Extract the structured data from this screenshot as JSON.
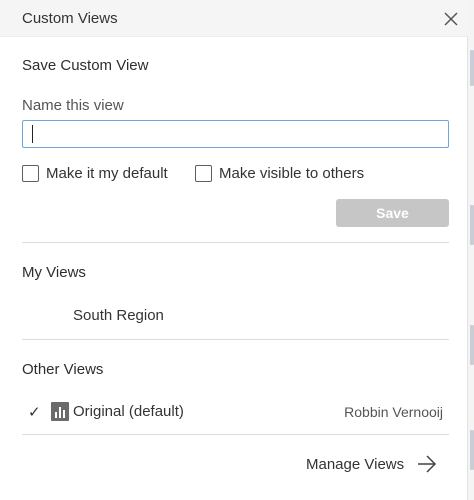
{
  "header": {
    "title": "Custom Views"
  },
  "save_section": {
    "title": "Save Custom View",
    "name_label": "Name this view",
    "name_value": "",
    "default_checkbox_label": "Make it my default",
    "visible_checkbox_label": "Make visible to others",
    "save_button_label": "Save"
  },
  "my_views": {
    "title": "My Views",
    "items": [
      {
        "label": "South Region"
      }
    ]
  },
  "other_views": {
    "title": "Other Views",
    "items": [
      {
        "checkmark": "✓",
        "label": "Original (default)",
        "owner": "Robbin Vernooij"
      }
    ]
  },
  "footer": {
    "manage_label": "Manage Views"
  },
  "colors": {
    "input_focus_border": "#6ea6d8",
    "save_button_disabled": "#c6c6c6",
    "header_bg": "#f5f5f5"
  },
  "icons": {
    "close": "close-icon",
    "view": "bar-chart-view-icon",
    "manage": "arrow-right-icon"
  }
}
